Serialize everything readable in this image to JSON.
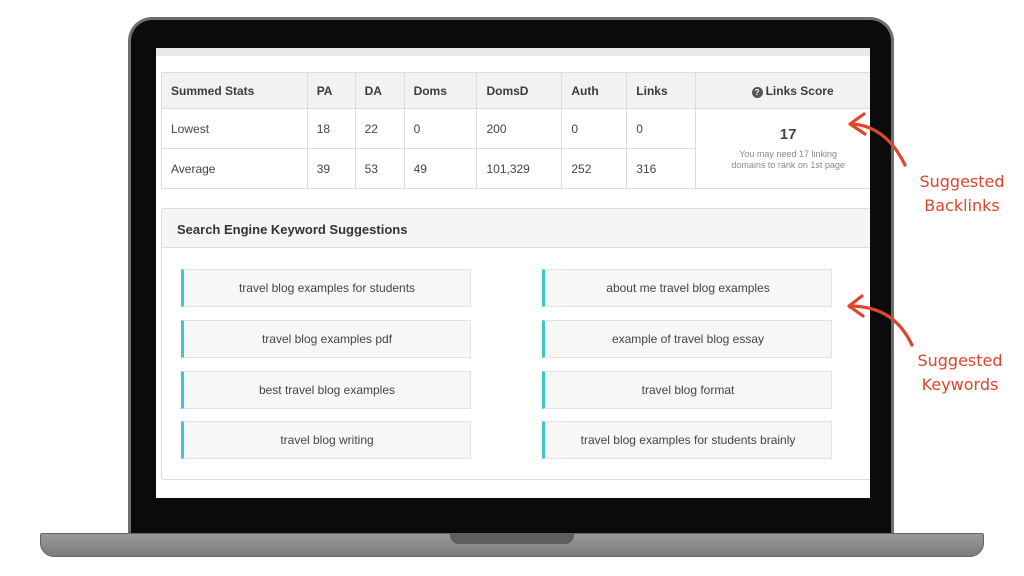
{
  "stats": {
    "headers": [
      "Summed Stats",
      "PA",
      "DA",
      "Doms",
      "DomsD",
      "Auth",
      "Links"
    ],
    "links_score_header": "Links Score",
    "rows": [
      {
        "label": "Lowest",
        "values": [
          "18",
          "22",
          "0",
          "200",
          "0",
          "0"
        ]
      },
      {
        "label": "Average",
        "values": [
          "39",
          "53",
          "49",
          "101,329",
          "252",
          "316"
        ]
      }
    ],
    "links_score": {
      "value": "17",
      "note_line1": "You may need 17 linking",
      "note_line2": "domains to rank on 1st page"
    }
  },
  "keyword_panel": {
    "title": "Search Engine Keyword Suggestions",
    "left": [
      "travel blog examples for students",
      "travel blog examples pdf",
      "best travel blog examples",
      "travel blog writing"
    ],
    "right": [
      "about me travel blog examples",
      "example of travel blog essay",
      "travel blog format",
      "travel blog examples for students brainly"
    ]
  },
  "annotations": {
    "backlinks_line1": "Suggested",
    "backlinks_line2": "Backlinks",
    "keywords_line1": "Suggested",
    "keywords_line2": "Keywords"
  },
  "colors": {
    "accent_teal": "#3cc8c8",
    "annotation_red": "#e0442b"
  },
  "icons": {
    "links_score_icon": "question-circle-icon"
  }
}
